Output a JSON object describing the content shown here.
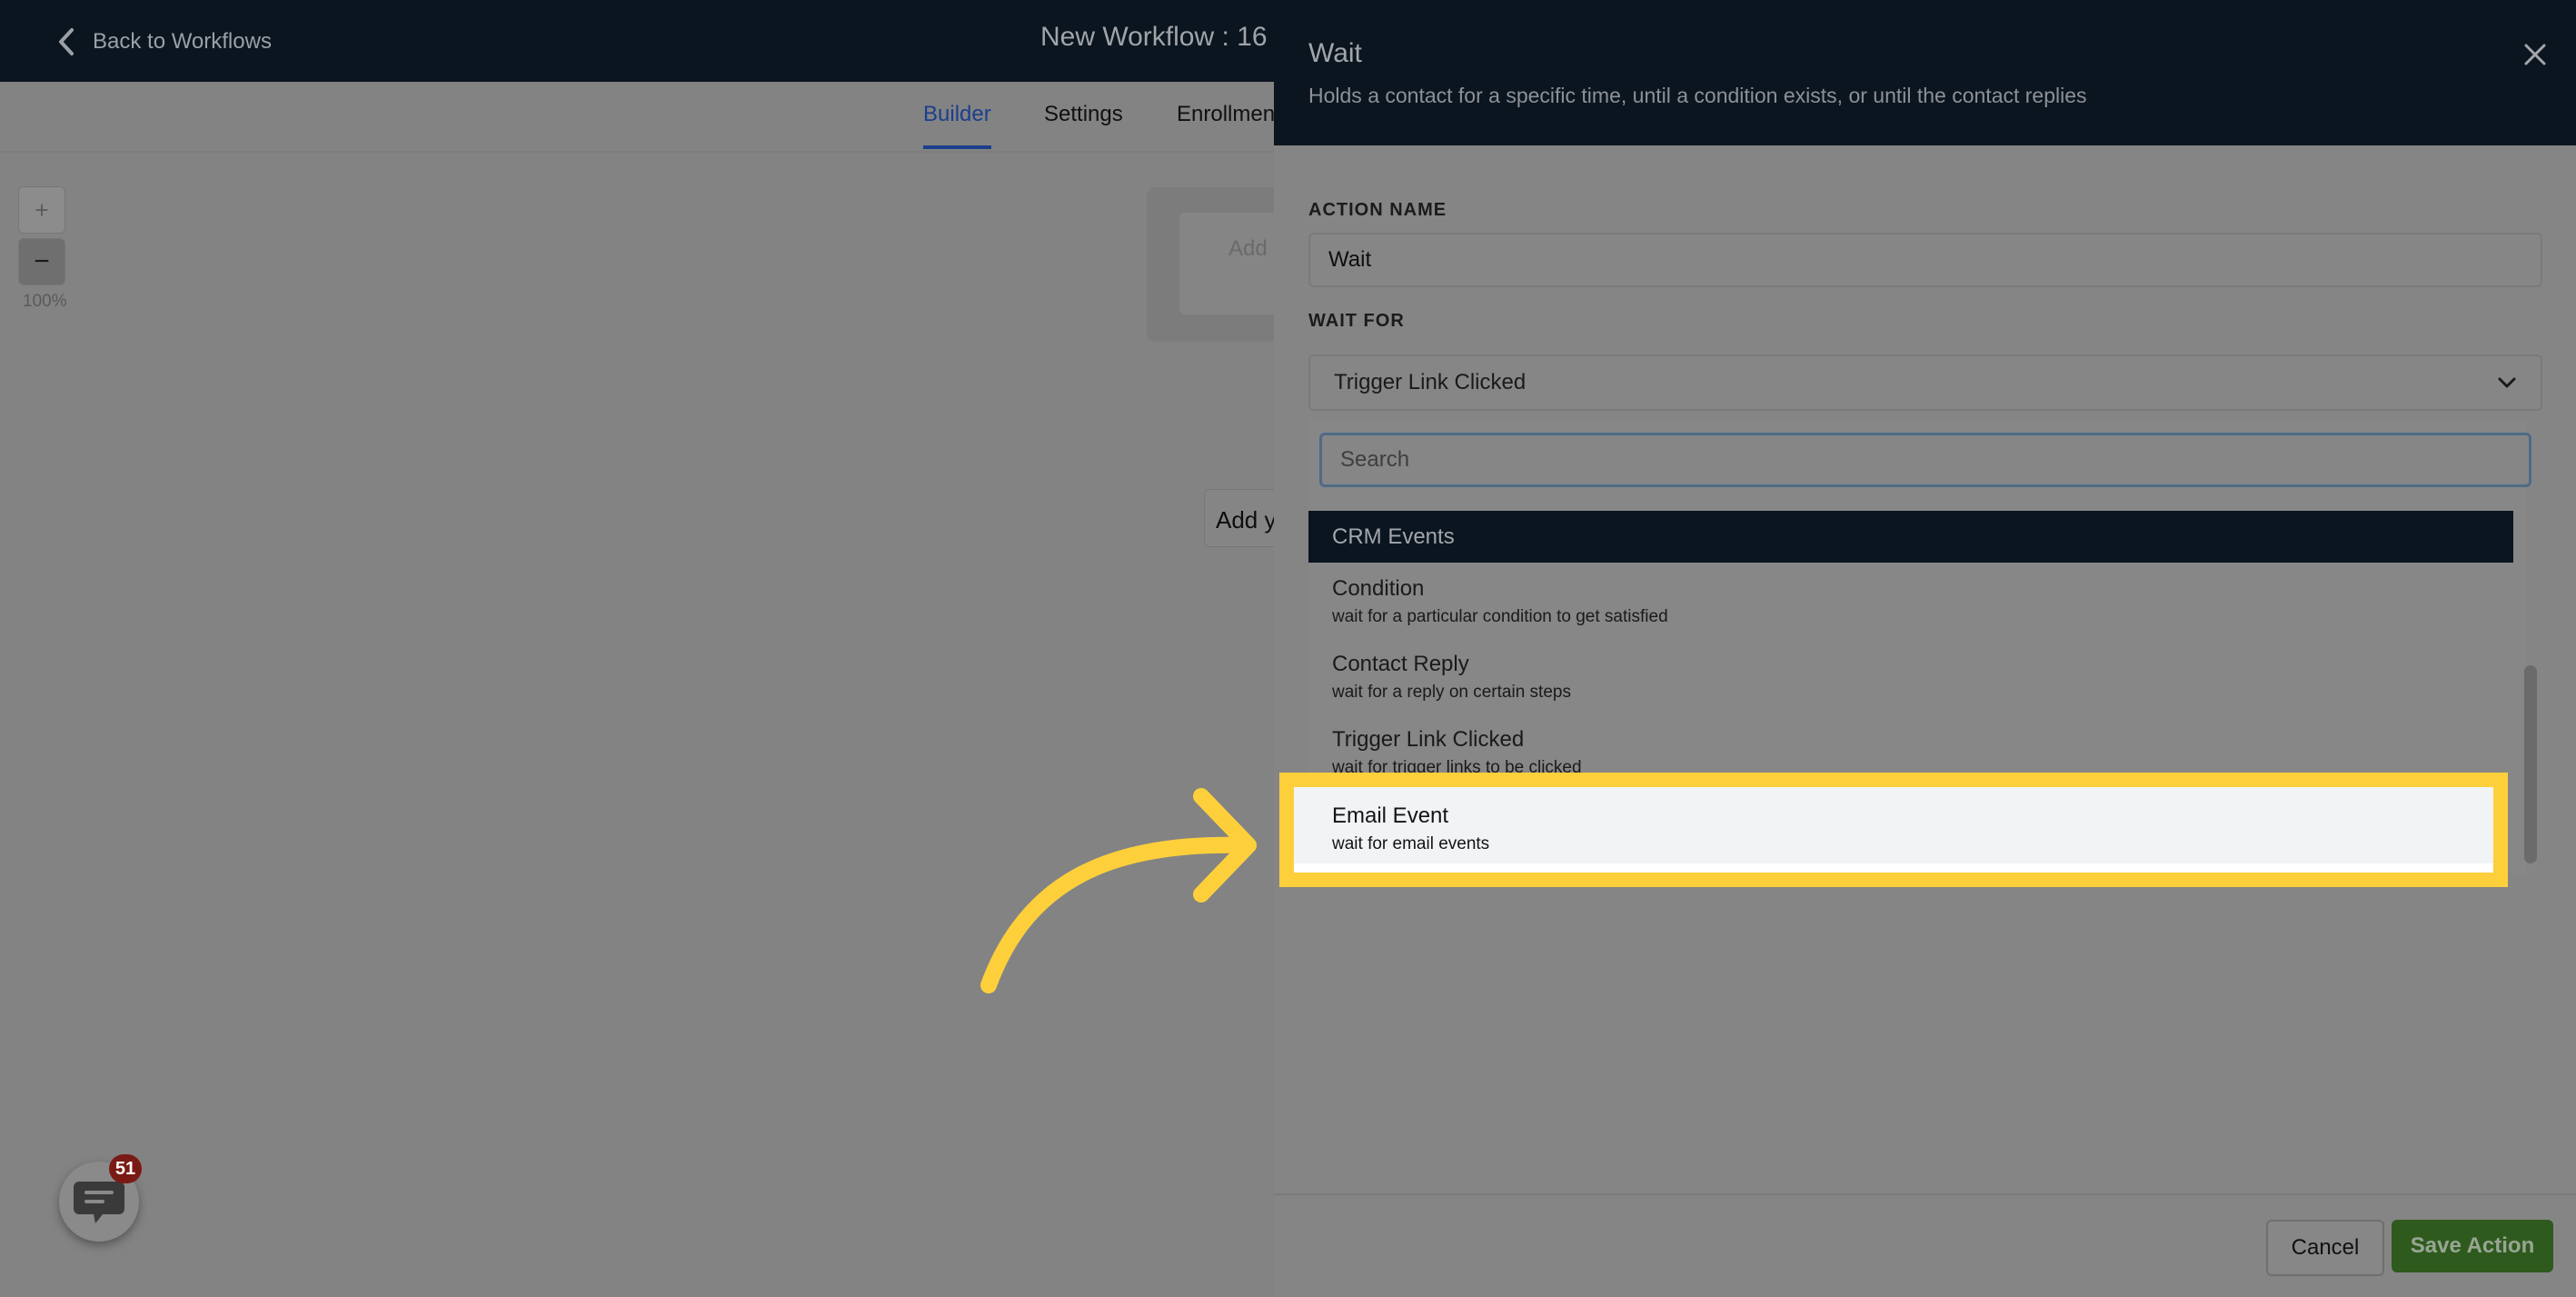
{
  "topbar": {
    "back_label": "Back to Workflows",
    "workflow_title": "New Workflow : 16"
  },
  "tabs": [
    {
      "label": "Builder",
      "active": true
    },
    {
      "label": "Settings",
      "active": false
    },
    {
      "label": "Enrollmen",
      "active": false
    }
  ],
  "canvas": {
    "zoom_in_label": "+",
    "zoom_out_label": "−",
    "zoom_level": "100%",
    "trigger_card_text": "Add",
    "add_node_text": "Add y"
  },
  "chat_widget": {
    "badge_count": "51"
  },
  "drawer": {
    "title": "Wait",
    "subtitle": "Holds a contact for a specific time, until a condition exists, or until the contact replies",
    "action_name_label": "ACTION NAME",
    "action_name_value": "Wait",
    "wait_for_label": "WAIT FOR",
    "wait_for_value": "Trigger Link Clicked",
    "search_placeholder": "Search",
    "group_header": "CRM Events",
    "options": [
      {
        "title": "Condition",
        "desc": "wait for a particular condition to get satisfied"
      },
      {
        "title": "Contact Reply",
        "desc": "wait for a reply on certain steps"
      },
      {
        "title": "Trigger Link Clicked",
        "desc": "wait for trigger links to be clicked"
      }
    ],
    "highlighted_option": {
      "title": "Email Event",
      "desc": "wait for email events"
    },
    "cancel_label": "Cancel",
    "save_label": "Save Action"
  },
  "colors": {
    "header_bg": "#0b1520",
    "active_tab": "#1c3f8c",
    "highlight": "#fdd03b",
    "save_button": "#2e5b1d",
    "badge": "#7a1a14"
  },
  "icons": [
    "chevron-left-icon",
    "close-icon",
    "chevron-down-icon",
    "chat-icon",
    "arrow-icon"
  ]
}
